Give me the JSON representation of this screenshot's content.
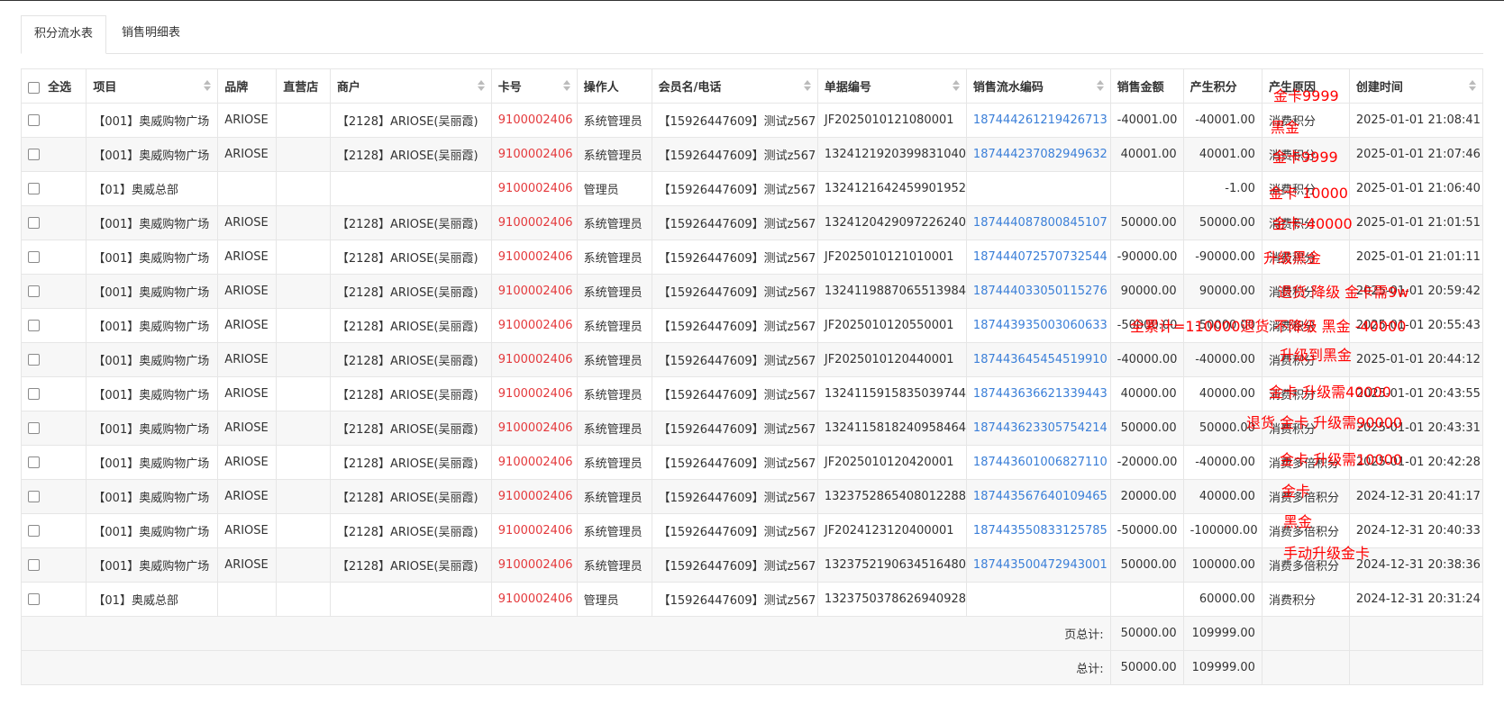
{
  "tabs": [
    {
      "label": "积分流水表",
      "active": true
    },
    {
      "label": "销售明细表",
      "active": false
    }
  ],
  "columns": {
    "select_all": "全选",
    "project": "项目",
    "brand": "品牌",
    "direct_store": "直营店",
    "merchant": "商户",
    "card_no": "卡号",
    "operator": "操作人",
    "member": "会员名/电话",
    "doc_no": "单据编号",
    "serial": "销售流水编码",
    "amount": "销售金额",
    "points": "产生积分",
    "reason": "产生原因",
    "created": "创建时间"
  },
  "rows": [
    {
      "project": "【001】奥威购物广场",
      "brand": "ARIOSE",
      "direct": "",
      "merchant": "【2128】ARIOSE(吴丽霞)",
      "card": "9100002406",
      "operator": "系统管理员",
      "member": "【15926447609】测试z567",
      "doc": "JF2025010121080001",
      "serial": "187444261219426713",
      "amount": "-40001.00",
      "points": "-40001.00",
      "reason": "消费积分",
      "time": "2025-01-01 21:08:41"
    },
    {
      "project": "【001】奥威购物广场",
      "brand": "ARIOSE",
      "direct": "",
      "merchant": "【2128】ARIOSE(吴丽霞)",
      "card": "9100002406",
      "operator": "系统管理员",
      "member": "【15926447609】测试z567",
      "doc": "1324121920399831040",
      "serial": "187444237082949632",
      "amount": "40001.00",
      "points": "40001.00",
      "reason": "消费积分",
      "time": "2025-01-01 21:07:46"
    },
    {
      "project": "【01】奥威总部",
      "brand": "",
      "direct": "",
      "merchant": "",
      "card": "9100002406",
      "operator": "管理员",
      "member": "【15926447609】测试z567",
      "doc": "1324121642459901952",
      "serial": "",
      "amount": "",
      "points": "-1.00",
      "reason": "消费积分",
      "time": "2025-01-01 21:06:40"
    },
    {
      "project": "【001】奥威购物广场",
      "brand": "ARIOSE",
      "direct": "",
      "merchant": "【2128】ARIOSE(吴丽霞)",
      "card": "9100002406",
      "operator": "系统管理员",
      "member": "【15926447609】测试z567",
      "doc": "1324120429097226240",
      "serial": "187444087800845107",
      "amount": "50000.00",
      "points": "50000.00",
      "reason": "消费积分",
      "time": "2025-01-01 21:01:51"
    },
    {
      "project": "【001】奥威购物广场",
      "brand": "ARIOSE",
      "direct": "",
      "merchant": "【2128】ARIOSE(吴丽霞)",
      "card": "9100002406",
      "operator": "系统管理员",
      "member": "【15926447609】测试z567",
      "doc": "JF2025010121010001",
      "serial": "187444072570732544",
      "amount": "-90000.00",
      "points": "-90000.00",
      "reason": "消费积分",
      "time": "2025-01-01 21:01:11"
    },
    {
      "project": "【001】奥威购物广场",
      "brand": "ARIOSE",
      "direct": "",
      "merchant": "【2128】ARIOSE(吴丽霞)",
      "card": "9100002406",
      "operator": "系统管理员",
      "member": "【15926447609】测试z567",
      "doc": "1324119887065513984",
      "serial": "187444033050115276",
      "amount": "90000.00",
      "points": "90000.00",
      "reason": "消费积分",
      "time": "2025-01-01 20:59:42"
    },
    {
      "project": "【001】奥威购物广场",
      "brand": "ARIOSE",
      "direct": "",
      "merchant": "【2128】ARIOSE(吴丽霞)",
      "card": "9100002406",
      "operator": "系统管理员",
      "member": "【15926447609】测试z567",
      "doc": "JF2025010120550001",
      "serial": "187443935003060633",
      "amount": "-50000.00",
      "points": "-50000.00",
      "reason": "消费积分",
      "time": "2025-01-01 20:55:43"
    },
    {
      "project": "【001】奥威购物广场",
      "brand": "ARIOSE",
      "direct": "",
      "merchant": "【2128】ARIOSE(吴丽霞)",
      "card": "9100002406",
      "operator": "系统管理员",
      "member": "【15926447609】测试z567",
      "doc": "JF2025010120440001",
      "serial": "187443645454519910",
      "amount": "-40000.00",
      "points": "-40000.00",
      "reason": "消费积分",
      "time": "2025-01-01 20:44:12"
    },
    {
      "project": "【001】奥威购物广场",
      "brand": "ARIOSE",
      "direct": "",
      "merchant": "【2128】ARIOSE(吴丽霞)",
      "card": "9100002406",
      "operator": "系统管理员",
      "member": "【15926447609】测试z567",
      "doc": "1324115915835039744",
      "serial": "187443636621339443",
      "amount": "40000.00",
      "points": "40000.00",
      "reason": "消费积分",
      "time": "2025-01-01 20:43:55"
    },
    {
      "project": "【001】奥威购物广场",
      "brand": "ARIOSE",
      "direct": "",
      "merchant": "【2128】ARIOSE(吴丽霞)",
      "card": "9100002406",
      "operator": "系统管理员",
      "member": "【15926447609】测试z567",
      "doc": "1324115818240958464",
      "serial": "187443623305754214",
      "amount": "50000.00",
      "points": "50000.00",
      "reason": "消费积分",
      "time": "2025-01-01 20:43:31"
    },
    {
      "project": "【001】奥威购物广场",
      "brand": "ARIOSE",
      "direct": "",
      "merchant": "【2128】ARIOSE(吴丽霞)",
      "card": "9100002406",
      "operator": "系统管理员",
      "member": "【15926447609】测试z567",
      "doc": "JF2025010120420001",
      "serial": "187443601006827110",
      "amount": "-20000.00",
      "points": "-40000.00",
      "reason": "消费多倍积分",
      "time": "2025-01-01 20:42:28"
    },
    {
      "project": "【001】奥威购物广场",
      "brand": "ARIOSE",
      "direct": "",
      "merchant": "【2128】ARIOSE(吴丽霞)",
      "card": "9100002406",
      "operator": "系统管理员",
      "member": "【15926447609】测试z567",
      "doc": "1323752865408012288",
      "serial": "187443567640109465",
      "amount": "20000.00",
      "points": "40000.00",
      "reason": "消费多倍积分",
      "time": "2024-12-31 20:41:17"
    },
    {
      "project": "【001】奥威购物广场",
      "brand": "ARIOSE",
      "direct": "",
      "merchant": "【2128】ARIOSE(吴丽霞)",
      "card": "9100002406",
      "operator": "系统管理员",
      "member": "【15926447609】测试z567",
      "doc": "JF2024123120400001",
      "serial": "187443550833125785",
      "amount": "-50000.00",
      "points": "-100000.00",
      "reason": "消费多倍积分",
      "time": "2024-12-31 20:40:33"
    },
    {
      "project": "【001】奥威购物广场",
      "brand": "ARIOSE",
      "direct": "",
      "merchant": "【2128】ARIOSE(吴丽霞)",
      "card": "9100002406",
      "operator": "系统管理员",
      "member": "【15926447609】测试z567",
      "doc": "1323752190634516480",
      "serial": "187443500472943001",
      "amount": "50000.00",
      "points": "100000.00",
      "reason": "消费多倍积分",
      "time": "2024-12-31 20:38:36"
    },
    {
      "project": "【01】奥威总部",
      "brand": "",
      "direct": "",
      "merchant": "",
      "card": "9100002406",
      "operator": "管理员",
      "member": "【15926447609】测试z567",
      "doc": "1323750378626940928",
      "serial": "",
      "amount": "",
      "points": "60000.00",
      "reason": "消费积分",
      "time": "2024-12-31 20:31:24"
    }
  ],
  "summary": {
    "page_total_label": "页总计:",
    "page_total_amount": "50000.00",
    "page_total_points": "109999.00",
    "total_label": "总计:",
    "total_amount": "50000.00",
    "total_points": "109999.00"
  },
  "annotations": [
    {
      "text": "金卡9999"
    },
    {
      "text": "黑金"
    },
    {
      "text": "金卡9999"
    },
    {
      "text": "金卡 10000"
    },
    {
      "text": "金卡-40000"
    },
    {
      "text": "升级黑金"
    },
    {
      "text": "退货 降级 金卡需9w"
    },
    {
      "text": "全累计=110000退货 不降级 黑金 -40000"
    },
    {
      "text": "升级到黑金"
    },
    {
      "text": "金卡 升级需40000"
    },
    {
      "text": "退货 金卡 升级需90000"
    },
    {
      "text": "金卡 升级需10000"
    },
    {
      "text": "金卡"
    },
    {
      "text": "黑金"
    },
    {
      "text": "手动升级金卡"
    }
  ],
  "colors": {
    "card_red": "#e4393c",
    "serial_blue": "#3b7fd8",
    "annotation_red": "#ff0000"
  }
}
